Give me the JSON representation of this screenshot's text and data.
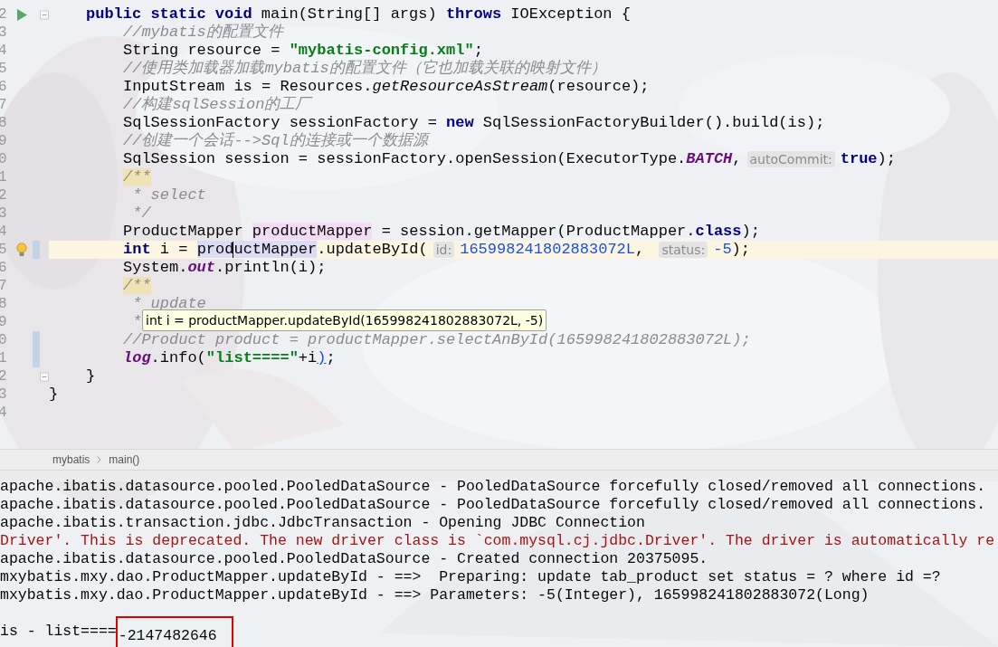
{
  "editor": {
    "lines": [
      {
        "number": "2",
        "run": true,
        "fold": true,
        "tokens": [
          {
            "kind": "keyword",
            "text": "public static void"
          },
          {
            "kind": "plain",
            "text": " main(String[] args) "
          },
          {
            "kind": "keyword",
            "text": "throws"
          },
          {
            "kind": "plain",
            "text": " IOException {"
          }
        ],
        "children": [
          {
            "number": "3",
            "tokens": [
              {
                "kind": "comment",
                "text": "//mybatis的配置文件"
              }
            ]
          },
          {
            "number": "4",
            "tokens": [
              {
                "kind": "plain",
                "text": "String resource = "
              },
              {
                "kind": "string",
                "text": "\"mybatis-config.xml\""
              },
              {
                "kind": "plain",
                "text": ";"
              }
            ]
          },
          {
            "number": "5",
            "tokens": [
              {
                "kind": "comment",
                "text": "//使用类加载器加载mybatis的配置文件（它也加载关联的映射文件）"
              }
            ]
          },
          {
            "number": "6",
            "tokens": [
              {
                "kind": "plain",
                "text": "InputStream is = Resources."
              },
              {
                "kind": "static-method",
                "text": "getResourceAsStream"
              },
              {
                "kind": "plain",
                "text": "(resource);"
              }
            ]
          },
          {
            "number": "7",
            "tokens": [
              {
                "kind": "comment",
                "text": "//构建sqlSession的工厂"
              }
            ]
          },
          {
            "number": "8",
            "tokens": [
              {
                "kind": "plain",
                "text": "SqlSessionFactory sessionFactory = "
              },
              {
                "kind": "keyword",
                "text": "new"
              },
              {
                "kind": "plain",
                "text": " SqlSessionFactoryBuilder().build(is);"
              }
            ]
          },
          {
            "number": "9",
            "tokens": [
              {
                "kind": "comment",
                "text": "//创建一个会话-->Sql的连接或一个数据源"
              }
            ]
          },
          {
            "number": "0",
            "tokens": [
              {
                "kind": "plain",
                "text": "SqlSession session = sessionFactory.openSession(ExecutorType."
              },
              {
                "kind": "constant",
                "text": "BATCH"
              },
              {
                "kind": "plain",
                "text": ","
              },
              {
                "kind": "hint",
                "text": "autoCommit:"
              },
              {
                "kind": "keyword",
                "text": "true"
              },
              {
                "kind": "plain",
                "text": ");"
              }
            ]
          },
          {
            "number": "1",
            "tokens": [
              {
                "kind": "doc-start",
                "text": "/**"
              }
            ]
          },
          {
            "number": "2",
            "tokens": [
              {
                "kind": "comment",
                "text": " * select"
              }
            ]
          },
          {
            "number": "3",
            "tokens": [
              {
                "kind": "comment",
                "text": " */"
              }
            ]
          },
          {
            "number": "4",
            "tokens": [
              {
                "kind": "plain",
                "text": "ProductMapper "
              },
              {
                "kind": "usage-write",
                "text": "productMapper"
              },
              {
                "kind": "plain",
                "text": " = session.getMapper(ProductMapper."
              },
              {
                "kind": "keyword",
                "text": "class"
              },
              {
                "kind": "plain",
                "text": ");"
              }
            ]
          },
          {
            "number": "5",
            "current": true,
            "changed": true,
            "bulb": true,
            "tokens": [
              {
                "kind": "keyword",
                "text": "int"
              },
              {
                "kind": "plain",
                "text": " i = "
              },
              {
                "kind": "usage-read",
                "text": "prod"
              },
              {
                "kind": "caret"
              },
              {
                "kind": "usage-read",
                "text": "uctMapper"
              },
              {
                "kind": "plain",
                "text": ".updateById("
              },
              {
                "kind": "hint",
                "text": "id:"
              },
              {
                "kind": "number",
                "text": "165998241802883072L"
              },
              {
                "kind": "plain",
                "text": ", "
              },
              {
                "kind": "hint",
                "text": "status:"
              },
              {
                "kind": "number",
                "text": "-5"
              },
              {
                "kind": "plain",
                "text": ");"
              }
            ]
          },
          {
            "number": "6",
            "tokens": [
              {
                "kind": "plain",
                "text": "System."
              },
              {
                "kind": "constant",
                "text": "out"
              },
              {
                "kind": "plain",
                "text": ".println(i);"
              }
            ]
          },
          {
            "number": "7",
            "tokens": [
              {
                "kind": "doc-start",
                "text": "/**"
              }
            ]
          },
          {
            "number": "8",
            "tokens": [
              {
                "kind": "comment",
                "text": " * update"
              }
            ]
          },
          {
            "number": "9",
            "tokens": [
              {
                "kind": "comment",
                "text": " *"
              }
            ]
          },
          {
            "number": "0",
            "changed": true,
            "tokens": [
              {
                "kind": "comment",
                "text": "//Product product = productMapper.selectAnById(165998241802883072L);"
              }
            ]
          },
          {
            "number": "1",
            "changed": true,
            "tokens": [
              {
                "kind": "constant",
                "text": "log"
              },
              {
                "kind": "plain",
                "text": ".info("
              },
              {
                "kind": "string",
                "text": "\"list====\""
              },
              {
                "kind": "plain",
                "text": "+i"
              },
              {
                "kind": "brace-match",
                "text": ")"
              },
              {
                "kind": "plain",
                "text": ";"
              }
            ]
          }
        ]
      },
      {
        "number": "2",
        "fold": true,
        "tokens": [
          {
            "kind": "plain",
            "text": "}"
          }
        ]
      }
    ],
    "outer_lines": [
      {
        "number": "3",
        "tokens": [
          {
            "kind": "plain",
            "text": "}"
          }
        ]
      },
      {
        "number": "4"
      }
    ],
    "tooltip": "int i = productMapper.updateById(165998241802883072L, -5)"
  },
  "breadcrumb": [
    "mybatis",
    "main()"
  ],
  "console": {
    "lines": [
      {
        "kind": "info",
        "segments": [
          {
            "text": "apache.ibatis.datasource.pooled.PooledDataSource - PooledDataSource forcefully closed/removed all connections."
          }
        ]
      },
      {
        "kind": "info",
        "segments": [
          {
            "text": "apache.ibatis.datasource.pooled.PooledDataSource - PooledDataSource forcefully closed/removed all connections."
          }
        ]
      },
      {
        "kind": "info",
        "segments": [
          {
            "text": "apache.ibatis.transaction.jdbc.JdbcTransaction - Opening JDBC Connection"
          }
        ]
      },
      {
        "kind": "error",
        "segments": [
          {
            "text": "Driver'. This is deprecated. The new driver class is `com.mysql.cj.jdbc.Driver'. The driver is automatically re"
          }
        ]
      },
      {
        "kind": "info",
        "segments": [
          {
            "text": "apache.ibatis.datasource.pooled.PooledDataSource - Created connection 20375095."
          }
        ]
      },
      {
        "kind": "info",
        "segments": [
          {
            "text": "mxybatis.mxy.dao.ProductMapper.updateById - ==>  Preparing: update tab_product set status = ? where id =?"
          }
        ]
      },
      {
        "kind": "info",
        "segments": [
          {
            "text": "mxybatis.mxy.dao.ProductMapper.updateById - ==> Parameters: -5(Integer), 165998241802883072(Long)"
          }
        ]
      },
      {
        "kind": "blank"
      },
      {
        "kind": "info",
        "segments": [
          {
            "text": "is - list===="
          },
          {
            "text": "-2147482646",
            "boxed": true
          }
        ]
      }
    ]
  }
}
